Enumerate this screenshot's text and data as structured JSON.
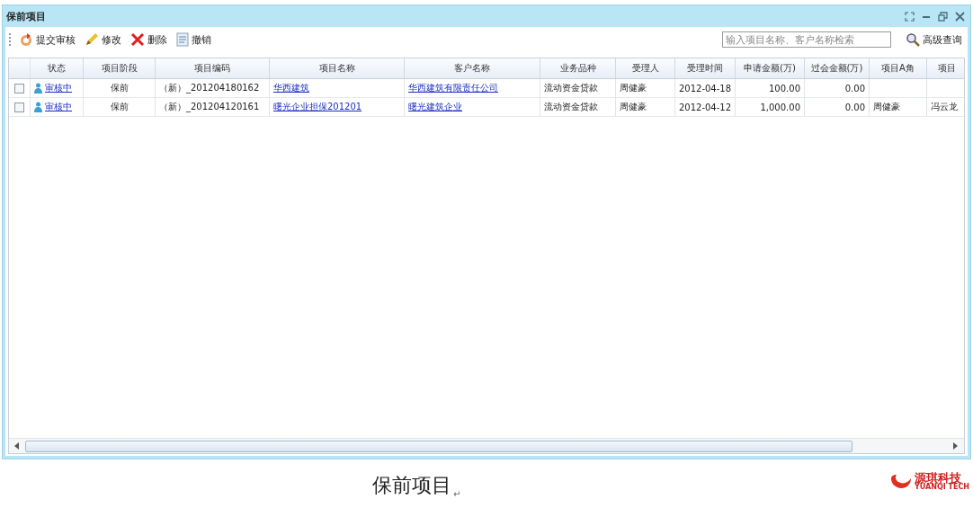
{
  "window": {
    "title": "保前项目"
  },
  "toolbar": [
    {
      "label": "提交审核",
      "kind": "submit"
    },
    {
      "label": "修改",
      "kind": "edit"
    },
    {
      "label": "删除",
      "kind": "delete"
    },
    {
      "label": "撤销",
      "kind": "revoke"
    }
  ],
  "search": {
    "placeholder": "输入项目名称、客户名称检索"
  },
  "advanced_search": "高级查询",
  "table": {
    "columns": [
      {
        "label": "状态",
        "kind": "status"
      },
      {
        "label": "项目阶段",
        "kind": "text"
      },
      {
        "label": "项目编码",
        "kind": "text"
      },
      {
        "label": "项目名称",
        "kind": "link"
      },
      {
        "label": "客户名称",
        "kind": "link"
      },
      {
        "label": "业务品种",
        "kind": "text"
      },
      {
        "label": "受理人",
        "kind": "text"
      },
      {
        "label": "受理时间",
        "kind": "text"
      },
      {
        "label": "申请金额(万)",
        "kind": "text"
      },
      {
        "label": "过会金额(万)",
        "kind": "text"
      },
      {
        "label": "项目A角",
        "kind": "text"
      },
      {
        "label": "项目",
        "kind": "text"
      }
    ],
    "rows": [
      {
        "checked": false,
        "cells": [
          "审核中",
          "保前",
          "（新）_201204180162",
          "华西建筑",
          "华西建筑有限责任公司",
          "流动资金贷款",
          "周健豪",
          "2012-04-18",
          "100.00",
          "0.00"
        ]
      },
      {
        "checked": false,
        "cells": [
          "审核中",
          "保前",
          "（新）_201204120161",
          "曙光企业担保201201",
          "曙光建筑企业",
          "流动资金贷款",
          "周健豪",
          "2012-04-12",
          "1,000.00",
          "0.00",
          "周健豪",
          "冯云龙"
        ]
      }
    ]
  },
  "caption": "保前项目",
  "caption_mark": "↵",
  "logo": {
    "name": "源琪科技",
    "subtitle": "YUANQI TECH"
  }
}
